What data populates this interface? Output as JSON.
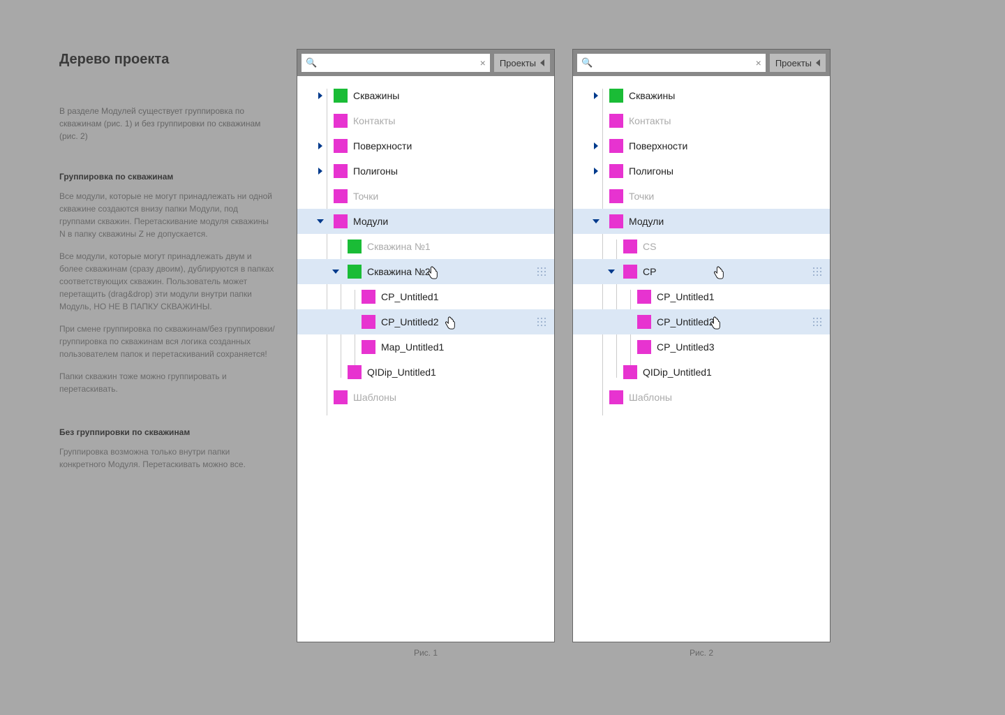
{
  "spec": {
    "title": "Дерево проекта",
    "intro": "В разделе Модулей существует группировка по скважинам (рис. 1) и без группировки по скважинам (рис. 2)",
    "section1_title": "Группировка по скважинам",
    "section1_p1": "Все модули, которые не могут принадлежать ни одной скважине создаются внизу папки Модули, под группами скважин. Перетаскивание модуля скважины N в папку скважины Z не допускается.",
    "section1_p2": "Все модули, которые могут принадлежать двум и более скважинам (сразу двоим), дублируются в папках соответствующих скважин. Пользователь может перетащить (drag&drop) эти модули внутри папки Модуль, НО НЕ В ПАПКУ СКВАЖИНЫ.",
    "section1_p3": "При смене группировка по скважинам/без группировки/группировка по скважинам вся логика созданных пользователем папок и перетаскиваний сохраняется!",
    "section1_p4": "Папки скважин тоже можно группировать и перетаскивать.",
    "section2_title": "Без группировки по скважинам",
    "section2_p1": "Группировка возможна только внутри папки конкретного Модуля. Перетаскивать можно все."
  },
  "search_placeholder": "",
  "projects_btn": "Проекты",
  "panel1": {
    "caption": "Рис. 1",
    "items": {
      "skv": "Скважины",
      "kont": "Контакты",
      "pov": "Поверхности",
      "polig": "Полигоны",
      "toch": "Точки",
      "mod": "Модули",
      "skv1": "Скважина №1",
      "skv2": "Скважина №2",
      "cp1": "CP_Untitled1",
      "cp2": "CP_Untitled2",
      "map1": "Map_Untitled1",
      "qidip": "QIDip_Untitled1",
      "shabl": "Шаблоны"
    }
  },
  "panel2": {
    "caption": "Рис. 2",
    "items": {
      "skv": "Скважины",
      "kont": "Контакты",
      "pov": "Поверхности",
      "polig": "Полигоны",
      "toch": "Точки",
      "mod": "Модули",
      "cs": "CS",
      "cp": "CP",
      "cp1": "CP_Untitled1",
      "cp2": "CP_Untitled2",
      "cp3": "CP_Untitled3",
      "qidip": "QIDip_Untitled1",
      "shabl": "Шаблоны"
    }
  }
}
